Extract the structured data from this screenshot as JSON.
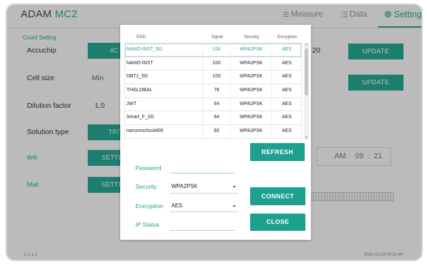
{
  "app": {
    "title_brand": "ADAM",
    "title_model": "MC2",
    "version": "V. 1.1.2",
    "datetime": "2020-12-03 09:21:44"
  },
  "nav": {
    "measure": {
      "label": "Measure",
      "icon": "menu-icon"
    },
    "data": {
      "label": "Data",
      "icon": "list-icon"
    },
    "setting": {
      "label": "Setting",
      "icon": "gear-icon",
      "active": true
    }
  },
  "settings": {
    "section_title": "Count Setting",
    "accuchip": {
      "label": "Accuchip",
      "button": "4C",
      "value": "20",
      "update": "UPDATE"
    },
    "cell_size": {
      "label": "Cell size",
      "value": "Min",
      "update": "UPDATE"
    },
    "dilution_factor": {
      "label": "Dilution factor",
      "value": "1.0"
    },
    "solution_type": {
      "label": "Solution type",
      "button": "TP/T"
    },
    "wifi": {
      "label": "Wifi",
      "button": "SETTI"
    },
    "mail": {
      "label": "Mail",
      "button": "SETTI"
    },
    "time": {
      "ampm": "AM",
      "hour": "09",
      "separator": ":",
      "minute": "21"
    }
  },
  "wifi_dialog": {
    "columns": [
      "SSID",
      "Signal",
      "Security",
      "Encryption"
    ],
    "selected_index": 0,
    "networks": [
      {
        "ssid": "NANO-INST_5G",
        "signal": 100,
        "security": "WPA2PSK",
        "encryption": "AES"
      },
      {
        "ssid": "NANO-INST",
        "signal": 100,
        "security": "WPA2PSK",
        "encryption": "AES"
      },
      {
        "ssid": "DBT1_5G",
        "signal": 100,
        "security": "WPA2PSK",
        "encryption": "AES"
      },
      {
        "ssid": "THGLOBAL",
        "signal": 76,
        "security": "WPA2PSK",
        "encryption": "AES"
      },
      {
        "ssid": "JWT",
        "signal": 64,
        "security": "WPA2PSK",
        "encryption": "AES"
      },
      {
        "ssid": "Smart_F_2G",
        "signal": 64,
        "security": "WPA2PSK",
        "encryption": "AES"
      },
      {
        "ssid": "nanumschool406",
        "signal": 60,
        "security": "WPA2PSK",
        "encryption": "AES"
      }
    ],
    "refresh_label": "REFRESH",
    "form": {
      "password_label": "Password",
      "password_value": "",
      "security_label": "Security",
      "security_value": "WPA2PSK",
      "encryption_label": "Encryption",
      "encryption_value": "AES",
      "ip_status_label": "IP Status",
      "ip_status_value": ""
    },
    "connect_label": "CONNECT",
    "close_label": "CLOSE"
  },
  "colors": {
    "accent": "#27a996",
    "dialog_button": "#1ea08e",
    "selected_row_text": "#2a9d96",
    "text": "#333333"
  }
}
